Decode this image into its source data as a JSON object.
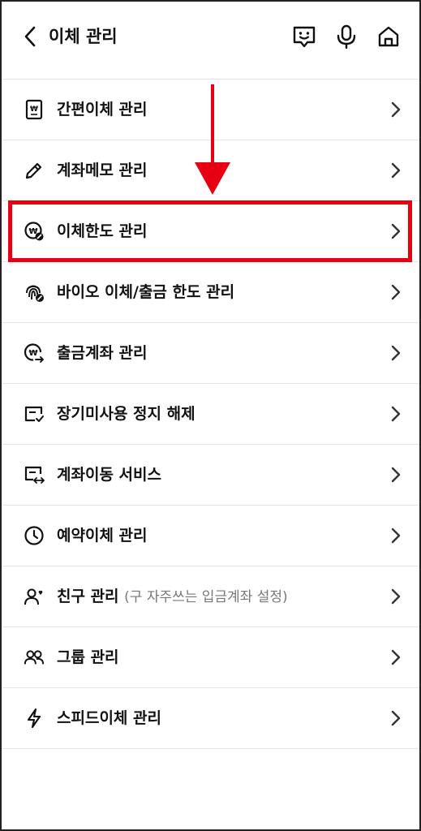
{
  "header": {
    "title": "이체 관리",
    "icons": [
      "back-icon",
      "chat-icon",
      "microphone-icon",
      "home-icon"
    ]
  },
  "menu": {
    "items": [
      {
        "label": "간편이체 관리",
        "icon": "won-card-icon"
      },
      {
        "label": "계좌메모 관리",
        "icon": "pencil-icon"
      },
      {
        "label": "이체한도 관리",
        "icon": "won-limit-icon"
      },
      {
        "label": "바이오 이체/출금 한도 관리",
        "icon": "fingerprint-icon"
      },
      {
        "label": "출금계좌 관리",
        "icon": "won-out-icon"
      },
      {
        "label": "장기미사용 정지 해제",
        "icon": "account-check-icon"
      },
      {
        "label": "계좌이동 서비스",
        "icon": "account-transfer-icon"
      },
      {
        "label": "예약이체 관리",
        "icon": "clock-icon"
      },
      {
        "label": "친구 관리",
        "sub": "(구 자주쓰는 입금계좌 설정)",
        "icon": "friend-icon"
      },
      {
        "label": "그룹 관리",
        "icon": "group-icon"
      },
      {
        "label": "스피드이체 관리",
        "icon": "lightning-icon"
      }
    ]
  },
  "colors": {
    "highlight": "#e60012",
    "arrow": "#e60012"
  }
}
